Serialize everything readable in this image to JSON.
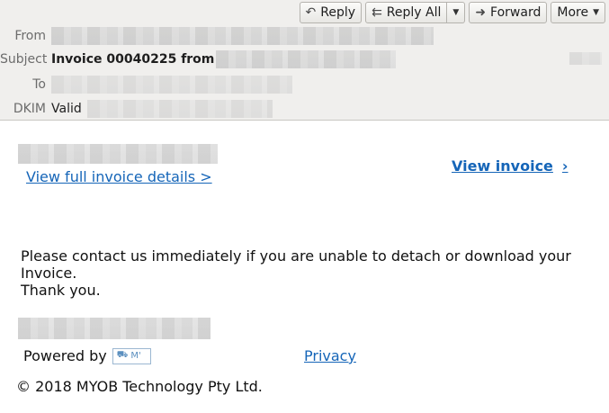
{
  "toolbar": {
    "reply_label": "Reply",
    "reply_all_label": "Reply All",
    "forward_label": "Forward",
    "more_label": "More"
  },
  "icons": {
    "reply": "reply-arrow-icon",
    "reply_all": "reply-all-arrow-icon",
    "forward": "forward-arrow-icon",
    "dropdown": "chevron-down-icon"
  },
  "headers": {
    "from_label": "From",
    "subject_label": "Subject",
    "subject_value": "Invoice 00040225 from",
    "to_label": "To",
    "dkim_label": "DKIM",
    "dkim_value": "Valid"
  },
  "body": {
    "view_full_details": "View full invoice details >",
    "view_invoice": "View invoice",
    "view_invoice_chevron": "›",
    "message_line1": "Please contact us immediately if you are unable to detach or download your Invoice.",
    "message_line2": "Thank you.",
    "powered_by": "Powered by",
    "logo_text": "M'",
    "privacy": "Privacy",
    "copyright": "© 2018 MYOB Technology Pty Ltd."
  },
  "colors": {
    "header_bg": "#f0efed",
    "link": "#1565b8",
    "label": "#6c6c6c"
  }
}
